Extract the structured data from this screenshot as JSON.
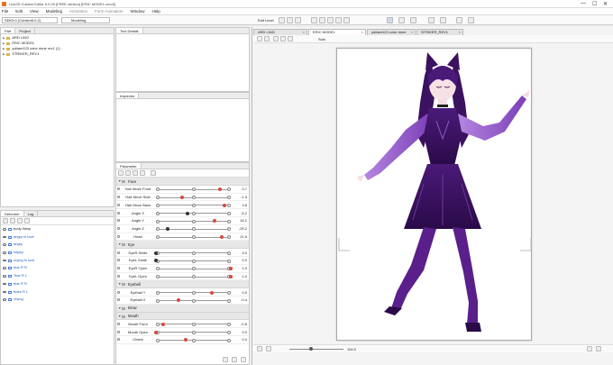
{
  "app": {
    "title": "Live2D Cubism Editor 5.0.00   [FREE version]   [ERIC MODEL.cmo3]",
    "window_controls": [
      "—",
      "☐",
      "✕"
    ]
  },
  "menu": [
    "File",
    "Edit",
    "View",
    "Modeling",
    "Animation",
    "Form Animation",
    "Window",
    "Help"
  ],
  "toolbar": {
    "workspace_select": "SDK5.0 (Cubism5.0.2)",
    "mode_select": "Modeling",
    "edit_level_label": "Edit Level",
    "edit_levels": [
      "1",
      "2",
      "3"
    ]
  },
  "left_top_panel": {
    "tabs": [
      "Part",
      "Project"
    ],
    "items": [
      "ARD LING",
      "ERIC MODEL",
      "yddam123 color done rev1 (1)",
      "STRIKER_REV1"
    ]
  },
  "tool_details": {
    "title": "Tool Details"
  },
  "inspector": {
    "title": "Inspector"
  },
  "parameter_panel": {
    "title": "Parameter",
    "groups": [
      {
        "name": "Face",
        "params": [
          {
            "label": "Hair Move Front",
            "value": "0.7",
            "knob": 0.85,
            "accent": "#d9473b"
          },
          {
            "label": "Hair Move Side",
            "value": "-1.3",
            "knob": 0.35,
            "accent": "#d9473b"
          },
          {
            "label": "Hair Move Back",
            "value": "0.6",
            "knob": 0.92,
            "accent": "#d9473b"
          },
          {
            "label": "Angle X",
            "value": "-5.2",
            "knob": 0.42,
            "accent": "#333333"
          },
          {
            "label": "Angle Y",
            "value": "15.2",
            "knob": 0.78,
            "accent": "#d9473b"
          },
          {
            "label": "Angle Z",
            "value": "-25.2",
            "knob": 0.16,
            "accent": "#333333"
          },
          {
            "label": "Head",
            "value": "21.6",
            "knob": 0.88,
            "accent": "#d9473b"
          }
        ]
      },
      {
        "name": "Eye",
        "params": [
          {
            "label": "EyeR Smile",
            "value": "0.0",
            "knob": 0.0,
            "accent": "#333333"
          },
          {
            "label": "EyeL Smile",
            "value": "0.0",
            "knob": 0.0,
            "accent": "#333333"
          },
          {
            "label": "EyeR Open",
            "value": "1.0",
            "knob": 1.0,
            "accent": "#d9473b"
          },
          {
            "label": "EyeL Open",
            "value": "1.0",
            "knob": 1.0,
            "accent": "#d9473b"
          }
        ]
      },
      {
        "name": "Eyeball",
        "params": [
          {
            "label": "Eyeball Y",
            "value": "0.5",
            "knob": 0.75,
            "accent": "#d9473b"
          },
          {
            "label": "Eyeball X",
            "value": "-0.4",
            "knob": 0.3,
            "accent": "#d9473b"
          }
        ]
      },
      {
        "name": "Brow",
        "params": []
      },
      {
        "name": "Mouth",
        "params": [
          {
            "label": "Mouth Form",
            "value": "-0.8",
            "knob": 0.1,
            "accent": "#d9473b"
          },
          {
            "label": "Mouth Open",
            "value": "0.0",
            "knob": 0.0,
            "accent": "#d9473b"
          },
          {
            "label": "Cheek",
            "value": "0.4",
            "knob": 0.4,
            "accent": "#d9473b"
          }
        ]
      }
    ]
  },
  "deformer_panel": {
    "tabs": [
      "Deformer",
      "Log"
    ],
    "items": [
      "body Warp",
      "angry fx love",
      "angry",
      "happy",
      "crying fx love",
      "tear R R",
      "Tear R L",
      "tear R R",
      "tears R L",
      "crying"
    ]
  },
  "doc_tabs": [
    "ARD LING",
    "ERIC MODEL",
    "yddam123 color done",
    "STRIKER_REV1"
  ],
  "view": {
    "solo_label": "Solo",
    "zoom": "100.0"
  },
  "colors": {
    "accent_purple": "#6a2b9e",
    "dark_purple": "#3b1160",
    "knob_red": "#d9473b"
  }
}
